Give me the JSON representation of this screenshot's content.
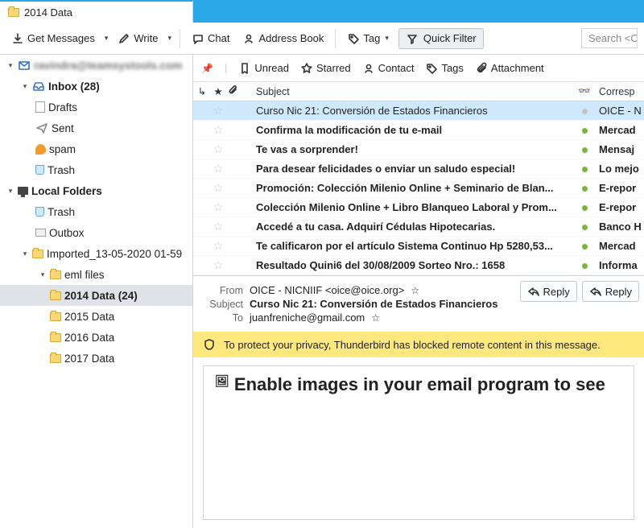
{
  "tab": {
    "title": "2014 Data"
  },
  "toolbar": {
    "get_messages": "Get Messages",
    "write": "Write",
    "chat": "Chat",
    "address_book": "Address Book",
    "tag": "Tag",
    "quick_filter": "Quick Filter",
    "search_placeholder": "Search <C"
  },
  "sidebar": {
    "account": "ravindra@teamsystools.com",
    "inbox": "Inbox (28)",
    "drafts": "Drafts",
    "sent": "Sent",
    "spam": "spam",
    "trash": "Trash",
    "local": "Local Folders",
    "local_trash": "Trash",
    "outbox": "Outbox",
    "imported": "Imported_13-05-2020 01-59",
    "eml": "eml files",
    "y2014": "2014 Data (24)",
    "y2015": "2015 Data",
    "y2016": "2016 Data",
    "y2017": "2017 Data"
  },
  "filterbar": {
    "unread": "Unread",
    "starred": "Starred",
    "contact": "Contact",
    "tags": "Tags",
    "attachment": "Attachment"
  },
  "listhead": {
    "subject": "Subject",
    "corr": "Corresp"
  },
  "messages": [
    {
      "subject": "Curso Nic 21: Conversión de Estados Financieros",
      "correspondent": "OICE - N",
      "unread": false,
      "selected": true,
      "dot": "grey"
    },
    {
      "subject": "Confirma la modificación de tu e-mail",
      "correspondent": "Mercad",
      "unread": true,
      "dot": "green"
    },
    {
      "subject": "Te vas a sorprender!",
      "correspondent": "Mensaj",
      "unread": true,
      "dot": "green"
    },
    {
      "subject": "Para desear felicidades o enviar un saludo especial!",
      "correspondent": "Lo mejo",
      "unread": true,
      "dot": "green"
    },
    {
      "subject": "Promoción: Colección Milenio Online + Seminario de Blan...",
      "correspondent": "E-repor",
      "unread": true,
      "dot": "green"
    },
    {
      "subject": "Colección Milenio Online + Libro Blanqueo Laboral y Prom...",
      "correspondent": "E-repor",
      "unread": true,
      "dot": "green"
    },
    {
      "subject": "Accedé a tu casa.  Adquirí Cédulas Hipotecarias.",
      "correspondent": "Banco H",
      "unread": true,
      "dot": "green"
    },
    {
      "subject": "Te calificaron por el artículo Sistema Continuo Hp 5280,53...",
      "correspondent": "Mercad",
      "unread": true,
      "dot": "green"
    },
    {
      "subject": "Resultado Quini6 del 30/08/2009 Sorteo Nro.: 1658",
      "correspondent": "Informa",
      "unread": true,
      "dot": "green"
    }
  ],
  "preview": {
    "from_lbl": "From",
    "from_val": "OICE - NICNIIF <oice@oice.org>",
    "subject_lbl": "Subject",
    "subject_val": "Curso Nic 21: Conversión de Estados Financieros",
    "to_lbl": "To",
    "to_val": "juanfreniche@gmail.com",
    "reply": "Reply",
    "reply2": "Reply",
    "warning": "To protect your privacy, Thunderbird has blocked remote content in this message.",
    "body": "Enable images in your email program to see"
  }
}
